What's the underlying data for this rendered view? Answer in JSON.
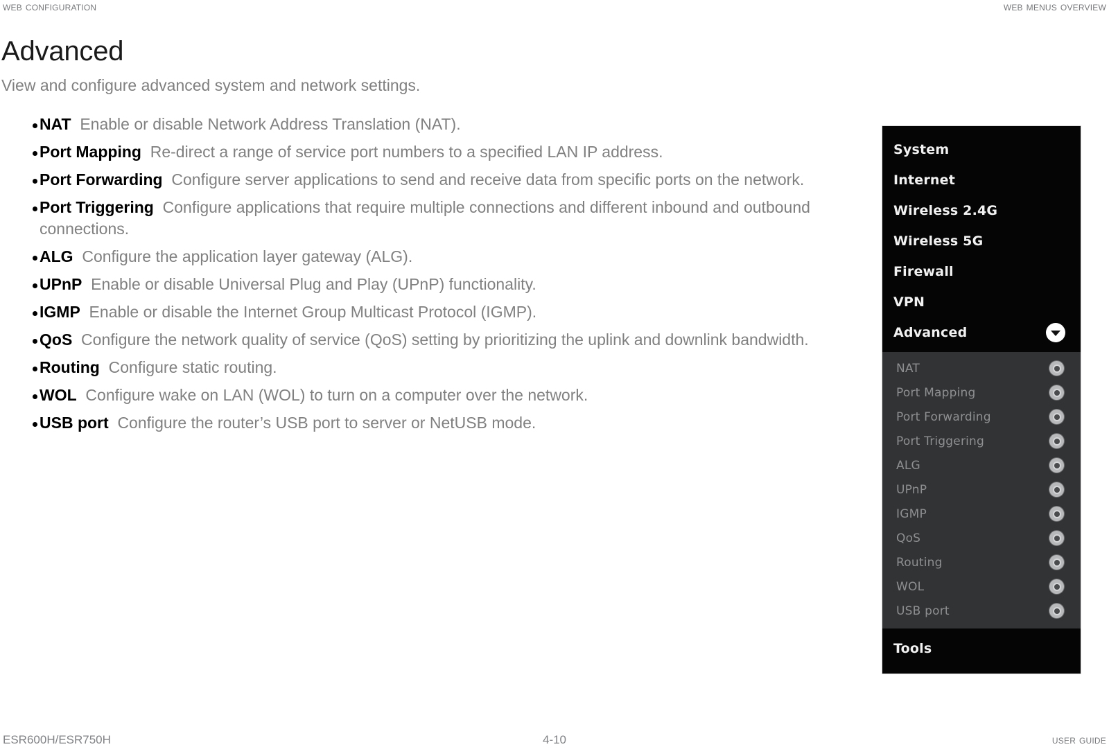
{
  "header": {
    "left": "Web Configuration",
    "right": "Web Menus Overview"
  },
  "main": {
    "title": "Advanced",
    "intro": "View and configure advanced system and network settings.",
    "bullets": [
      {
        "term": "NAT",
        "desc": "Enable or disable Network Address Translation (NAT)."
      },
      {
        "term": "Port Mapping",
        "desc": "Re-direct a range of service port numbers to a specified LAN IP address."
      },
      {
        "term": "Port Forwarding",
        "desc": "Configure server applications to send and receive data from specific ports on the network."
      },
      {
        "term": "Port Triggering",
        "desc": "Configure applications that require multiple connections and different inbound and outbound connections."
      },
      {
        "term": "ALG",
        "desc": "Configure the application layer gateway (ALG)."
      },
      {
        "term": "UPnP",
        "desc": "Enable or disable Universal Plug and Play (UPnP) functionality."
      },
      {
        "term": "IGMP",
        "desc": "Enable or disable the Internet Group Multicast Protocol (IGMP)."
      },
      {
        "term": "QoS",
        "desc": "Configure the network quality of service (QoS) setting by prioritizing the uplink and downlink bandwidth."
      },
      {
        "term": "Routing",
        "desc": "Configure static routing."
      },
      {
        "term": "WOL",
        "desc": "Configure wake on LAN (WOL) to turn on a computer over the network."
      },
      {
        "term": "USB port",
        "desc": "Configure the router’s USB port to server or NetUSB mode."
      }
    ]
  },
  "menu_figure": {
    "top_items": [
      {
        "label": "System",
        "icon": ""
      },
      {
        "label": "Internet",
        "icon": ""
      },
      {
        "label": "Wireless 2.4G",
        "icon": ""
      },
      {
        "label": "Wireless 5G",
        "icon": ""
      },
      {
        "label": "Firewall",
        "icon": ""
      },
      {
        "label": "VPN",
        "icon": ""
      },
      {
        "label": "Advanced",
        "icon": "chevron-down-icon"
      }
    ],
    "sub_items": [
      {
        "label": "NAT",
        "icon": "gear-icon"
      },
      {
        "label": "Port Mapping",
        "icon": "gear-icon"
      },
      {
        "label": "Port Forwarding",
        "icon": "gear-icon"
      },
      {
        "label": "Port Triggering",
        "icon": "gear-icon"
      },
      {
        "label": "ALG",
        "icon": "gear-icon"
      },
      {
        "label": "UPnP",
        "icon": "gear-icon"
      },
      {
        "label": "IGMP",
        "icon": "gear-icon"
      },
      {
        "label": "QoS",
        "icon": "gear-icon"
      },
      {
        "label": "Routing",
        "icon": "gear-icon"
      },
      {
        "label": "WOL",
        "icon": "gear-icon"
      },
      {
        "label": "USB port",
        "icon": "gear-icon"
      }
    ],
    "bottom_items": [
      {
        "label": "Tools",
        "icon": ""
      }
    ],
    "colors": {
      "menu_background": "#050505",
      "submenu_background": "#313335",
      "top_label": "#f2f2f2",
      "sub_label": "#8e8f91"
    }
  },
  "footer": {
    "left": "ESR600H/ESR750H",
    "center": "4-10",
    "right": "User Guide"
  }
}
